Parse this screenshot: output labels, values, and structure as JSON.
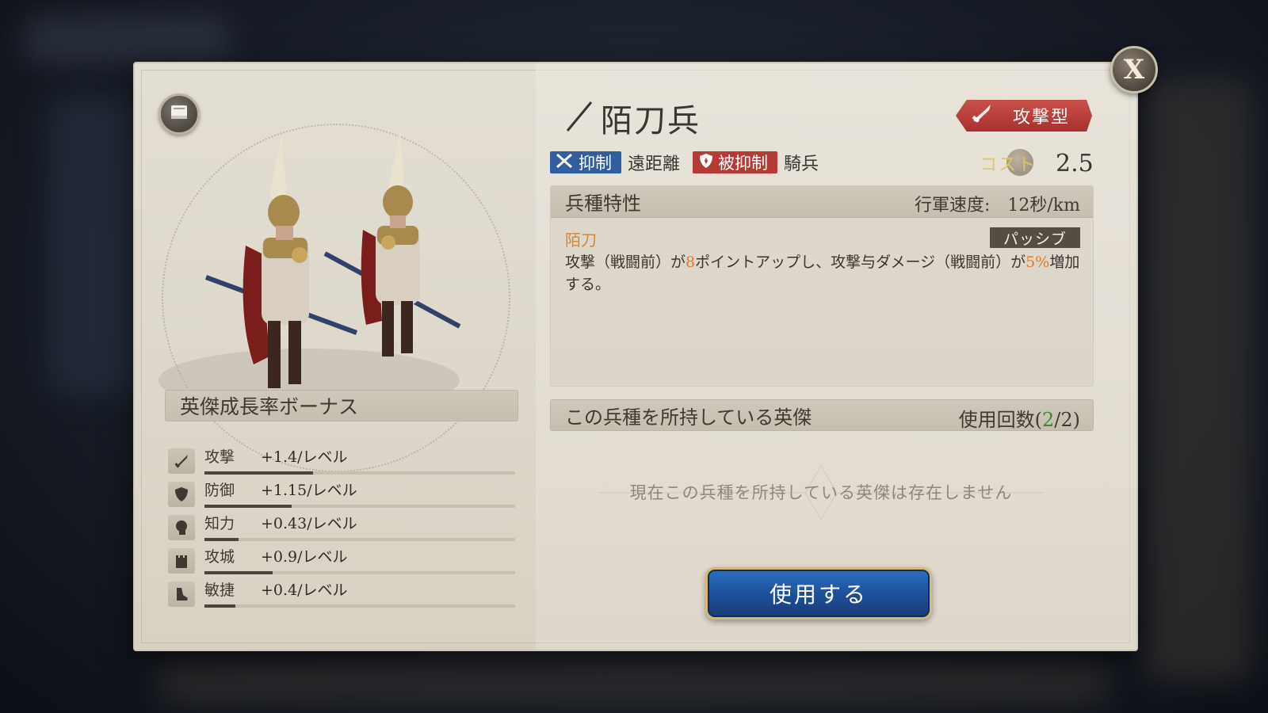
{
  "dialog": {
    "title": "陌刀兵",
    "type_badge": "攻撃型",
    "tags": {
      "counter_label": "抑制",
      "counter_target": "遠距離",
      "countered_label": "被抑制",
      "countered_by": "騎兵"
    },
    "cost": {
      "label": "コスト",
      "value": "2.5"
    }
  },
  "growth": {
    "heading": "英傑成長率ボーナス",
    "stats": [
      {
        "name": "攻撃",
        "value": "+1.4/レベル",
        "fill": 0.35,
        "icon": "sword-icon"
      },
      {
        "name": "防御",
        "value": "+1.15/レベル",
        "fill": 0.28,
        "icon": "shield-icon"
      },
      {
        "name": "知力",
        "value": "+0.43/レベル",
        "fill": 0.11,
        "icon": "head-icon"
      },
      {
        "name": "攻城",
        "value": "+0.9/レベル",
        "fill": 0.22,
        "icon": "tower-icon"
      },
      {
        "name": "敏捷",
        "value": "+0.4/レベル",
        "fill": 0.1,
        "icon": "boot-icon"
      }
    ]
  },
  "trait": {
    "heading": "兵種特性",
    "speed_label": "行軍速度:",
    "speed_value": "12秒/km",
    "skill_name": "陌刀",
    "skill_type": "パッシブ",
    "desc_1": "攻撃（戦闘前）が",
    "desc_2": "8",
    "desc_3": "ポイントアップし、攻撃与ダメージ（戦闘前）が",
    "desc_4": "5%",
    "desc_5": "増加する。"
  },
  "owners": {
    "heading": "この兵種を所持している英傑",
    "count_label": "使用回数(",
    "count_used": "2",
    "count_total": "/2)",
    "empty_text": "現在この兵種を所持している英傑は存在しません"
  },
  "actions": {
    "use_label": "使用する",
    "close_label": "X"
  },
  "colors": {
    "accent_blue": "#1d4f97",
    "attack_red": "#b63a36",
    "highlight": "#e07a2e"
  }
}
